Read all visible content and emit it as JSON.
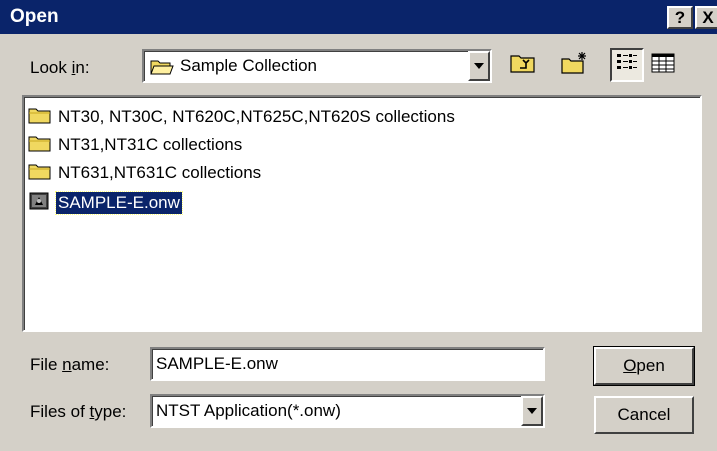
{
  "window": {
    "title": "Open",
    "help_glyph": "?",
    "close_glyph": "X"
  },
  "lookin": {
    "label_pre": "Look ",
    "label_accel": "i",
    "label_post": "n:",
    "value": "Sample Collection",
    "icon": "folder-open-icon"
  },
  "toolbar": {
    "up_icon": "up-one-level-icon",
    "new_folder_icon": "new-folder-icon",
    "list_icon": "list-view-icon",
    "details_icon": "details-view-icon"
  },
  "files": [
    {
      "name": "NT30, NT30C, NT620C,NT625C,NT620S collections",
      "icon": "folder-icon",
      "selected": false
    },
    {
      "name": "NT31,NT31C collections",
      "icon": "folder-icon",
      "selected": false
    },
    {
      "name": "NT631,NT631C collections",
      "icon": "folder-icon",
      "selected": false
    },
    {
      "name": "SAMPLE-E.onw",
      "icon": "application-file-icon",
      "selected": true
    }
  ],
  "filename": {
    "label_pre": "File ",
    "label_accel": "n",
    "label_post": "ame:",
    "value": "SAMPLE-E.onw"
  },
  "filetype": {
    "label_pre": "Files of ",
    "label_accel": "t",
    "label_post": "ype:",
    "value": "NTST Application(*.onw)"
  },
  "buttons": {
    "open_accel": "O",
    "open_rest": "pen",
    "cancel": "Cancel"
  },
  "colors": {
    "titlebar": "#0a246a",
    "face": "#d4d0c8",
    "folder": "#f0d860",
    "selection": "#0a246a"
  }
}
